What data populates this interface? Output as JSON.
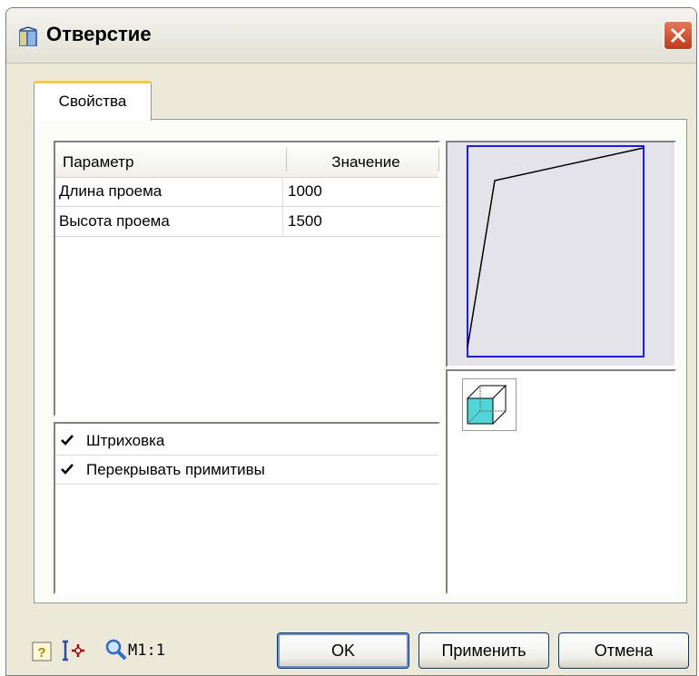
{
  "window": {
    "title": "Отверстие"
  },
  "tabs": [
    {
      "label": "Свойства"
    }
  ],
  "grid": {
    "headers": [
      "Параметр",
      "Значение"
    ],
    "rows": [
      {
        "name": "Длина проема",
        "value": "1000"
      },
      {
        "name": "Высота проема",
        "value": "1500"
      }
    ]
  },
  "checks": [
    {
      "label": "Штриховка",
      "checked": true
    },
    {
      "label": "Перекрывать примитивы",
      "checked": true
    }
  ],
  "footer": {
    "scale": "M1:1",
    "ok": "OK",
    "apply": "Применить",
    "cancel": "Отмена"
  },
  "icons": {
    "app": "door-app-icon",
    "close": "close-icon",
    "help": "help-icon",
    "snap": "snap-icon",
    "zoom": "zoom-icon",
    "view": "cube-3d-icon"
  },
  "colors": {
    "accent_tab": "#ffc83c",
    "preview_frame": "#1a1aff",
    "cube_face": "#4fd6d6"
  }
}
